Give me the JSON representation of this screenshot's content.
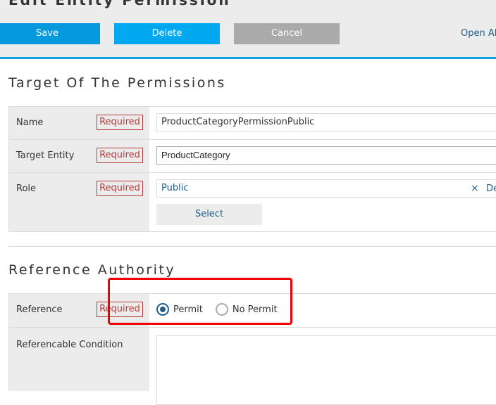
{
  "header": {
    "title": "Edit Entity Permission",
    "buttons": {
      "save": "Save",
      "delete": "Delete",
      "cancel": "Cancel"
    },
    "open_all": "Open All",
    "accent_color": "#0aa4e2"
  },
  "sections": {
    "target": {
      "title": "Target Of The Permissions",
      "required_label": "Required",
      "rows": {
        "name": {
          "label": "Name",
          "value": "ProductCategoryPermissionPublic"
        },
        "target_entity": {
          "label": "Target Entity",
          "value": "ProductCategory"
        },
        "role": {
          "label": "Role",
          "value": "Public",
          "clear_icon": "×",
          "delete_text": "De",
          "select_button": "Select"
        }
      }
    },
    "reference": {
      "title": "Reference Authority",
      "required_label": "Required",
      "rows": {
        "reference": {
          "label": "Reference",
          "options": [
            {
              "label": "Permit",
              "checked": true
            },
            {
              "label": "No Permit",
              "checked": false
            }
          ]
        },
        "condition": {
          "label": "Referencable Condition",
          "value": ""
        }
      }
    }
  },
  "colors": {
    "required": "#b83a3a",
    "link": "#1e5f8a",
    "highlight": "#f00000"
  }
}
